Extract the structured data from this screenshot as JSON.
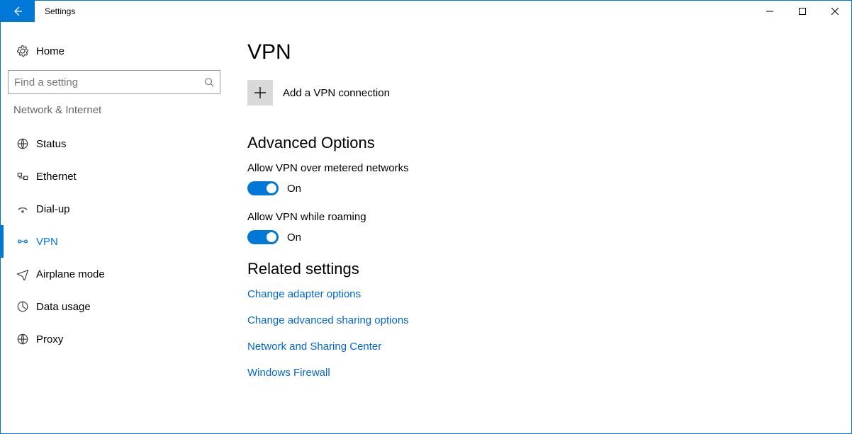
{
  "window": {
    "title": "Settings"
  },
  "sidebar": {
    "home": "Home",
    "search_placeholder": "Find a setting",
    "section": "Network & Internet",
    "items": [
      {
        "label": "Status"
      },
      {
        "label": "Ethernet"
      },
      {
        "label": "Dial-up"
      },
      {
        "label": "VPN"
      },
      {
        "label": "Airplane mode"
      },
      {
        "label": "Data usage"
      },
      {
        "label": "Proxy"
      }
    ]
  },
  "main": {
    "title": "VPN",
    "add_label": "Add a VPN connection",
    "advanced_heading": "Advanced Options",
    "settings": [
      {
        "label": "Allow VPN over metered networks",
        "state": "On"
      },
      {
        "label": "Allow VPN while roaming",
        "state": "On"
      }
    ],
    "related_heading": "Related settings",
    "links": [
      "Change adapter options",
      "Change advanced sharing options",
      "Network and Sharing Center",
      "Windows Firewall"
    ]
  }
}
